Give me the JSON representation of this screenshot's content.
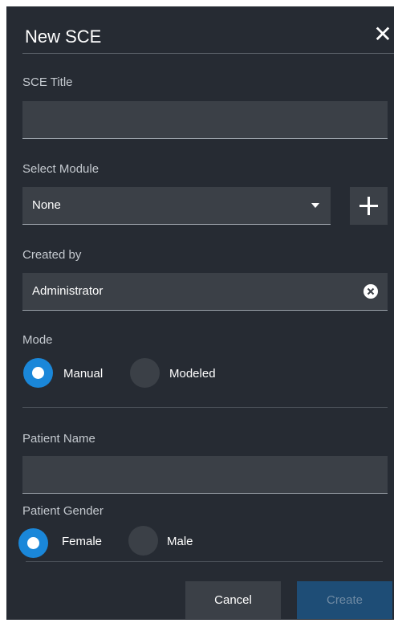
{
  "dialog": {
    "title": "New SCE",
    "close_glyph": "✕"
  },
  "fields": {
    "sce_title": {
      "label": "SCE Title",
      "value": ""
    },
    "module": {
      "label": "Select Module",
      "value": "None",
      "add_icon": "plus-icon"
    },
    "created_by": {
      "label": "Created by",
      "value": "Administrator",
      "clear_icon": "clear-x-icon"
    },
    "mode": {
      "label": "Mode",
      "options": [
        {
          "label": "Manual",
          "selected": true
        },
        {
          "label": "Modeled",
          "selected": false
        }
      ]
    },
    "patient_name": {
      "label": "Patient Name",
      "value": ""
    },
    "patient_gender": {
      "label": "Patient Gender",
      "options": [
        {
          "label": "Female",
          "selected": true
        },
        {
          "label": "Male",
          "selected": false
        }
      ]
    }
  },
  "buttons": {
    "cancel": "Cancel",
    "create": "Create"
  },
  "colors": {
    "background": "#262b33",
    "field": "#3b4047",
    "accent": "#1a87d9",
    "create_disabled": "#1e4d76"
  }
}
